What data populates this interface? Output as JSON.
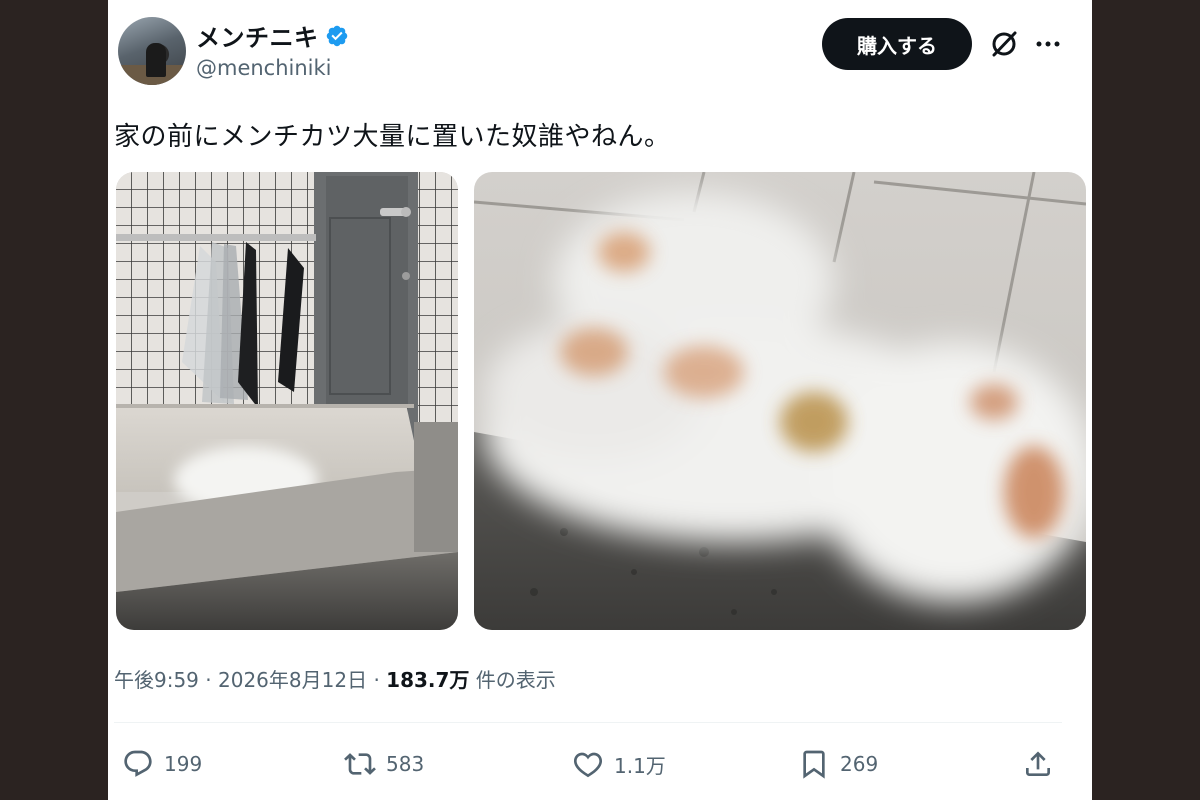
{
  "user": {
    "display_name": "メンチニキ",
    "handle": "@menchiniki",
    "verified_icon": "verified-badge-icon"
  },
  "header": {
    "subscribe_label": "購入する"
  },
  "tweet": {
    "text": "家の前にメンチカツ大量に置いた奴誰やねん。",
    "time": "午後9:59",
    "sep1": "·",
    "date": "2026年8月12日",
    "sep2": "·",
    "views_count": "183.7万",
    "views_label": "件の表示"
  },
  "actions": {
    "replies": "199",
    "reposts": "583",
    "likes": "1.1万",
    "bookmarks": "269"
  },
  "colors": {
    "background": "#2b2321",
    "card": "#ffffff",
    "verified": "#1d9bf0",
    "secondary_text": "#536471"
  }
}
